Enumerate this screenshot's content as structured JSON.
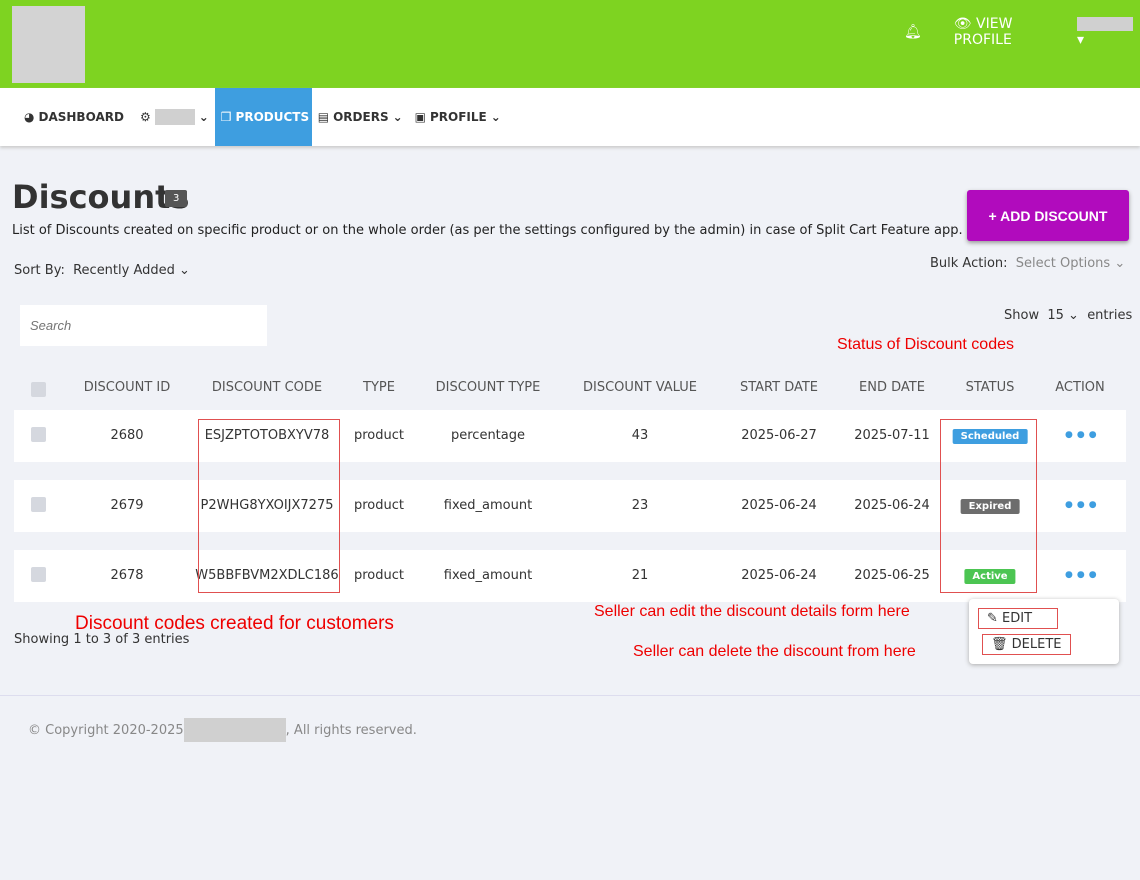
{
  "header": {
    "view_profile": "VIEW PROFILE"
  },
  "nav": {
    "dashboard": "DASHBOARD",
    "products": "PRODUCTS",
    "orders": "ORDERS",
    "profile": "PROFILE"
  },
  "page": {
    "title": "Discounts",
    "count": "3",
    "description": "List of Discounts created on specific product or on the whole order (as per the settings configured by the admin) in case of Split Cart Feature app.",
    "add_button": "+ ADD DISCOUNT",
    "sort_label": "Sort By:",
    "sort_value": "Recently Added",
    "bulk_label": "Bulk Action:",
    "bulk_value": "Select Options",
    "search_placeholder": "Search",
    "show_label": "Show",
    "show_value": "15",
    "entries_label": "entries",
    "showing": "Showing 1 to 3 of 3 entries"
  },
  "table": {
    "headers": [
      "DISCOUNT ID",
      "DISCOUNT CODE",
      "TYPE",
      "DISCOUNT TYPE",
      "DISCOUNT VALUE",
      "START DATE",
      "END DATE",
      "STATUS",
      "ACTION"
    ],
    "rows": [
      {
        "id": "2680",
        "code": "ESJZPTOTOBXYV78",
        "type": "product",
        "dtype": "percentage",
        "value": "43",
        "start": "2025-06-27",
        "end": "2025-07-11",
        "status": "Scheduled"
      },
      {
        "id": "2679",
        "code": "P2WHG8YXOIJX7275",
        "type": "product",
        "dtype": "fixed_amount",
        "value": "23",
        "start": "2025-06-24",
        "end": "2025-06-24",
        "status": "Expired"
      },
      {
        "id": "2678",
        "code": "W5BBFBVM2XDLC186",
        "type": "product",
        "dtype": "fixed_amount",
        "value": "21",
        "start": "2025-06-24",
        "end": "2025-06-25",
        "status": "Active"
      }
    ]
  },
  "status_colors": {
    "Scheduled": "#3e9ee0",
    "Expired": "#6d6d6d",
    "Active": "#4cc552"
  },
  "menu": {
    "edit": "EDIT",
    "delete": "DELETE"
  },
  "annotations": {
    "status": "Status of Discount codes",
    "codes": "Discount codes created for customers",
    "edit": "Seller can edit the discount details form here",
    "delete": "Seller can delete the discount from here"
  },
  "footer": {
    "prefix": "© Copyright 2020-2025",
    "suffix": ", All rights reserved."
  }
}
